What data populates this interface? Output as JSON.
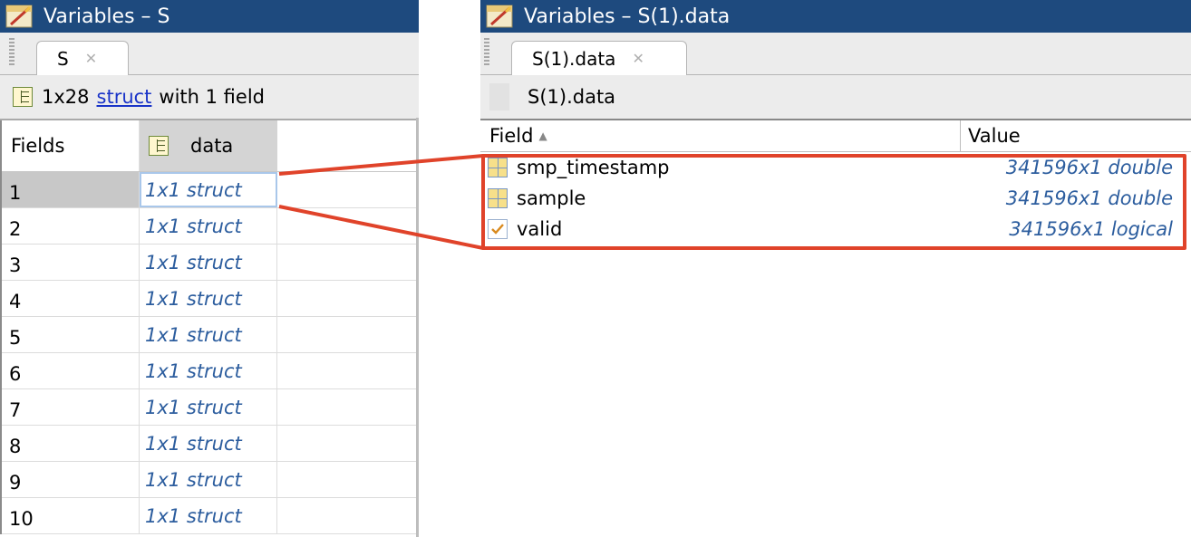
{
  "left_panel": {
    "title": "Variables – S",
    "tab": {
      "label": "S",
      "close": "✕"
    },
    "info": {
      "size": "1x28",
      "link": "struct",
      "suffix": "with 1 field"
    },
    "grid": {
      "header_fields": "Fields",
      "header_data": "data",
      "rows": [
        {
          "index": "1",
          "value": "1x1 struct"
        },
        {
          "index": "2",
          "value": "1x1 struct"
        },
        {
          "index": "3",
          "value": "1x1 struct"
        },
        {
          "index": "4",
          "value": "1x1 struct"
        },
        {
          "index": "5",
          "value": "1x1 struct"
        },
        {
          "index": "6",
          "value": "1x1 struct"
        },
        {
          "index": "7",
          "value": "1x1 struct"
        },
        {
          "index": "8",
          "value": "1x1 struct"
        },
        {
          "index": "9",
          "value": "1x1 struct"
        },
        {
          "index": "10",
          "value": "1x1 struct"
        }
      ]
    }
  },
  "right_panel": {
    "title": "Variables – S(1).data",
    "tab": {
      "label": "S(1).data",
      "close": "✕"
    },
    "breadcrumb": "S(1).data",
    "table": {
      "header_field": "Field",
      "sort_indicator": "▲",
      "header_value": "Value",
      "rows": [
        {
          "icon": "matrix-icon",
          "field": "smp_timestamp",
          "value": "341596x1 double"
        },
        {
          "icon": "matrix-icon",
          "field": "sample",
          "value": "341596x1 double"
        },
        {
          "icon": "logical-check-icon",
          "field": "valid",
          "value": "341596x1 logical"
        }
      ]
    }
  },
  "colors": {
    "titlebar": "#1e4a7e",
    "value_text": "#2c5d9e",
    "link": "#1a34c8",
    "annotation": "#e0432a"
  }
}
